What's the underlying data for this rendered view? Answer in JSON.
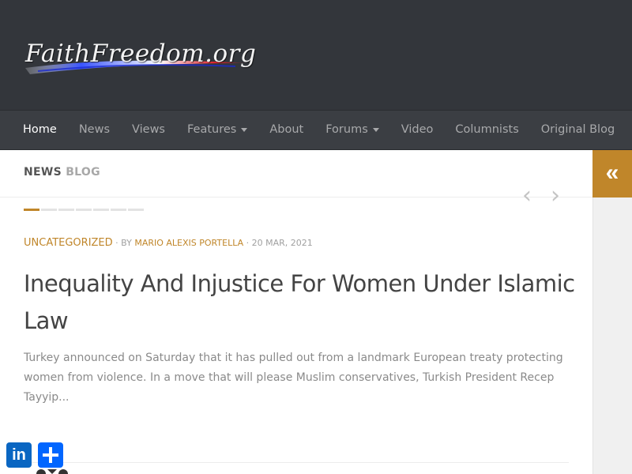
{
  "header": {
    "logo_text": "FaithFreedom.org"
  },
  "nav": {
    "items": [
      {
        "label": "Home",
        "active": true,
        "dropdown": false
      },
      {
        "label": "News",
        "active": false,
        "dropdown": false
      },
      {
        "label": "Views",
        "active": false,
        "dropdown": false
      },
      {
        "label": "Features",
        "active": false,
        "dropdown": true
      },
      {
        "label": "About",
        "active": false,
        "dropdown": false
      },
      {
        "label": "Forums",
        "active": false,
        "dropdown": true
      },
      {
        "label": "Video",
        "active": false,
        "dropdown": false
      },
      {
        "label": "Columnists",
        "active": false,
        "dropdown": false
      },
      {
        "label": "Original Blog",
        "active": false,
        "dropdown": false
      }
    ]
  },
  "sidebar": {
    "toggle_glyph": "«",
    "toggle_icon": "double-chevron-left-icon"
  },
  "section": {
    "title_word1": "NEWS",
    "title_word2": "BLOG"
  },
  "slider": {
    "prev_glyph": "‹",
    "next_glyph": "›",
    "dot_count": 7,
    "active_dot": 0
  },
  "post": {
    "category": "UNCATEGORIZED",
    "separator1": " · ",
    "by_label": "BY",
    "author": "MARIO ALEXIS PORTELLA",
    "separator2": " · ",
    "date": "20 MAR, 2021",
    "title": "Inequality And Injustice For Women Under Islamic Law",
    "excerpt": "Turkey announced on Saturday that it has pulled out from a landmark European treaty protecting women from violence. In a move that will please Muslim conservatives, Turkish President Recep Tayyip..."
  },
  "share": {
    "linkedin_label": "in",
    "linkedin_icon": "linkedin-icon",
    "add_icon": "share-plus-icon"
  },
  "colors": {
    "header_bg": "#33363b",
    "nav_bg": "#3b3e43",
    "accent": "#c0862a",
    "linkedin": "#0a66c2",
    "share_add": "#0166ff"
  }
}
